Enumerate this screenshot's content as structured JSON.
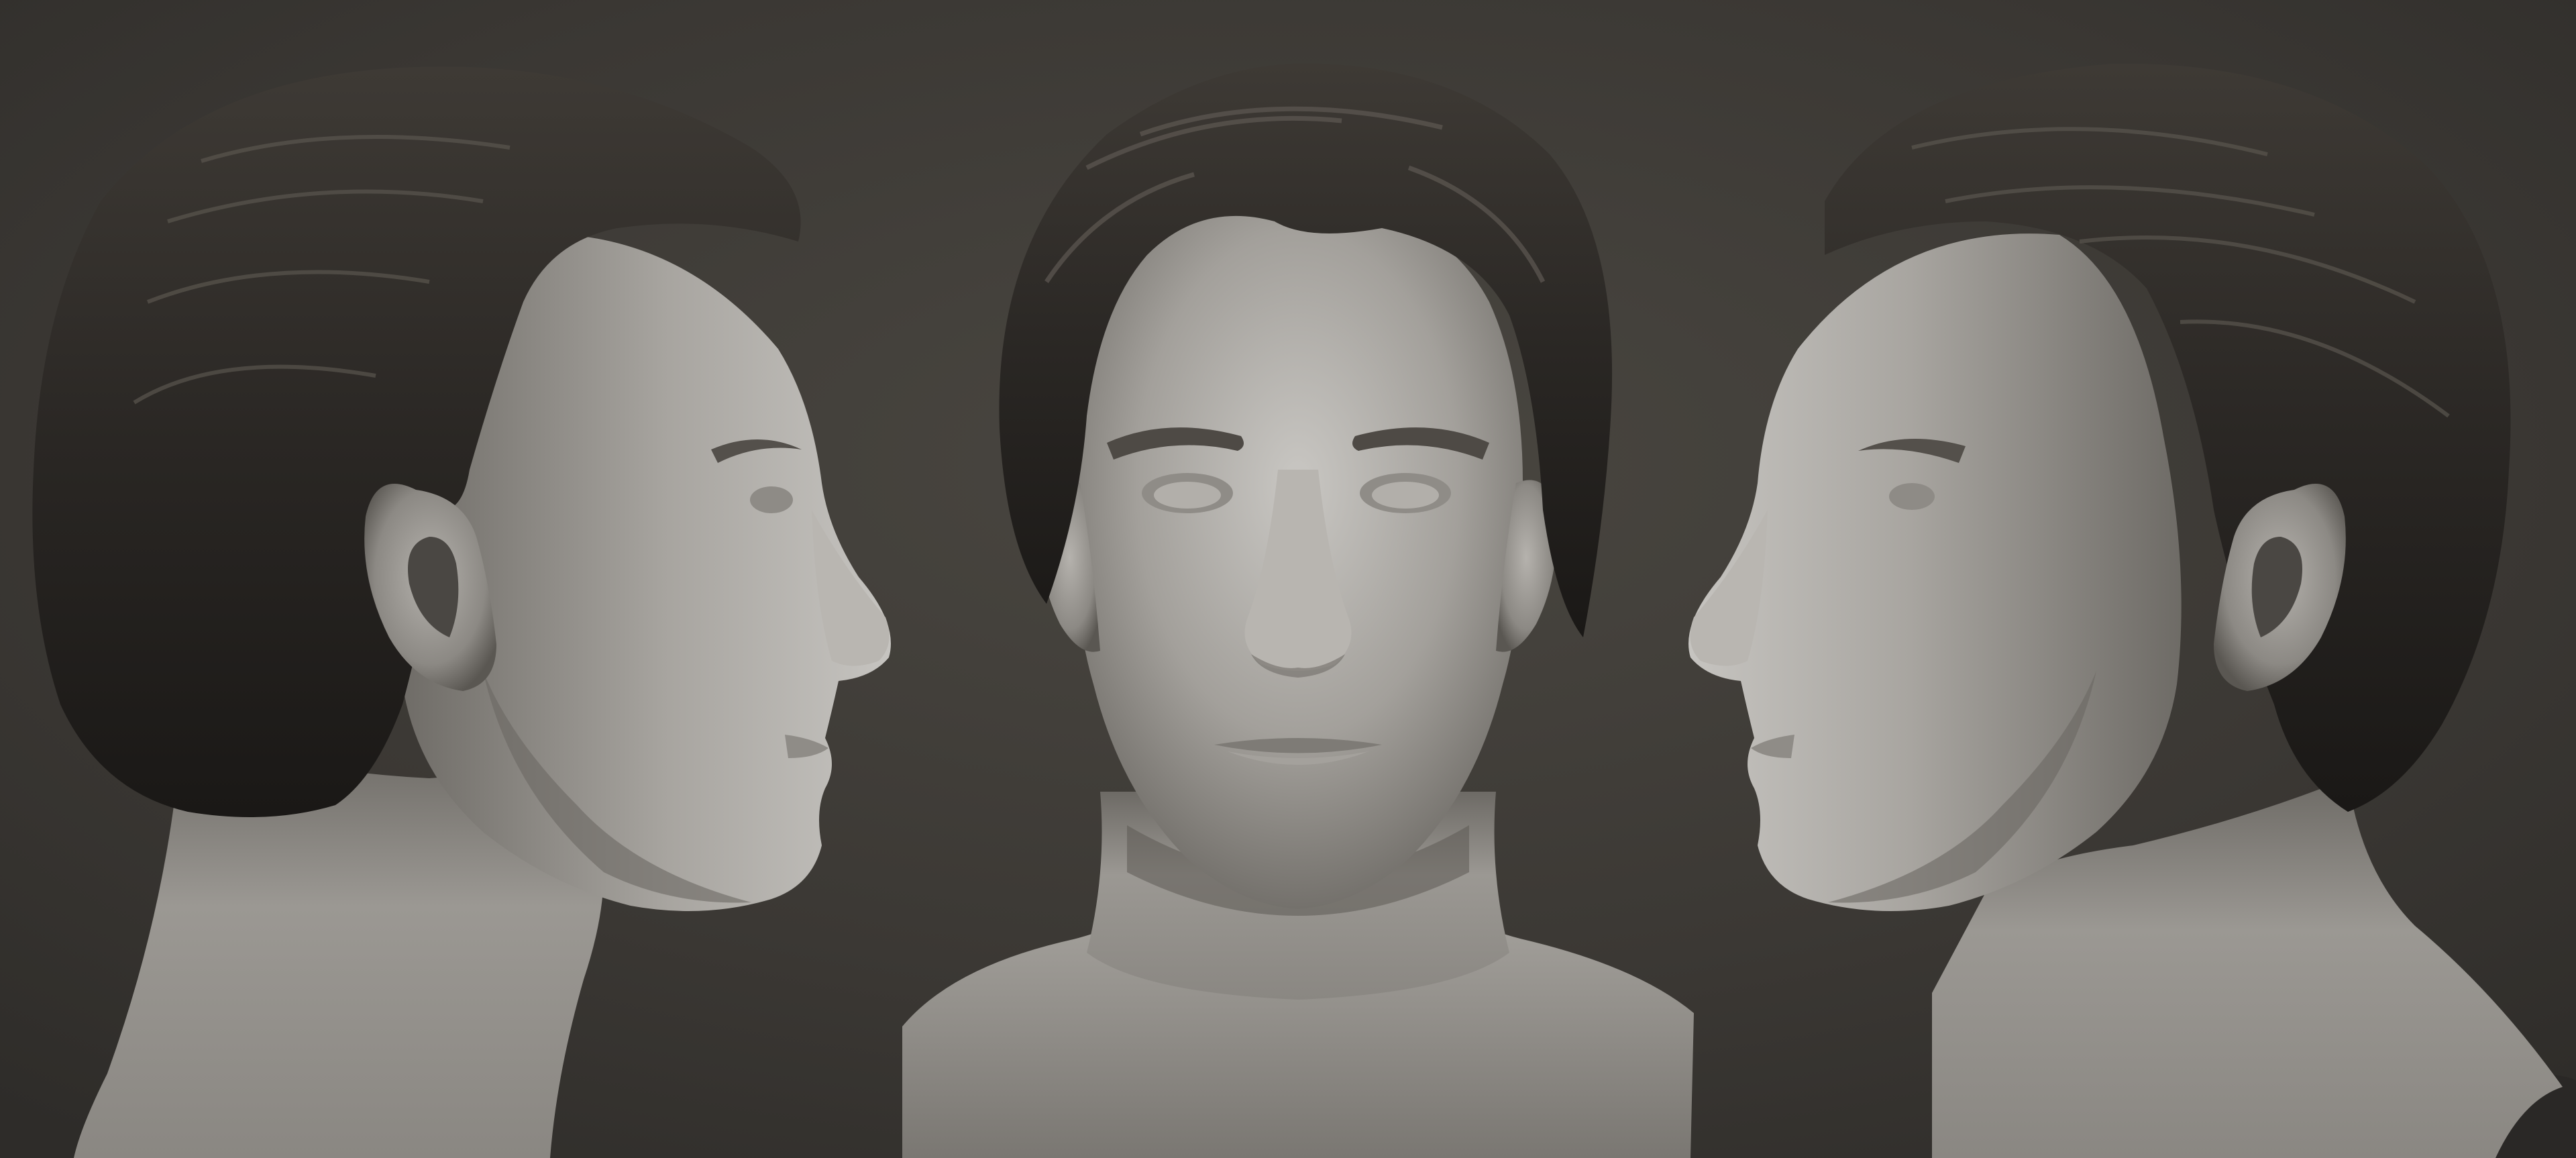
{
  "scene": {
    "subject": "sculpt-turnaround",
    "views": [
      {
        "view": "profile-right-facing"
      },
      {
        "view": "front"
      },
      {
        "view": "profile-left-facing"
      }
    ],
    "colors": {
      "background": "#3a3733",
      "background_center": "#48453f",
      "skin_light": "#c8c6c2",
      "skin_mid": "#9d9a95",
      "skin_dark": "#5e5b56",
      "hair_dark": "#201e1c",
      "hair_mid": "#3a3632",
      "hair_highlight": "#6a655e"
    }
  }
}
